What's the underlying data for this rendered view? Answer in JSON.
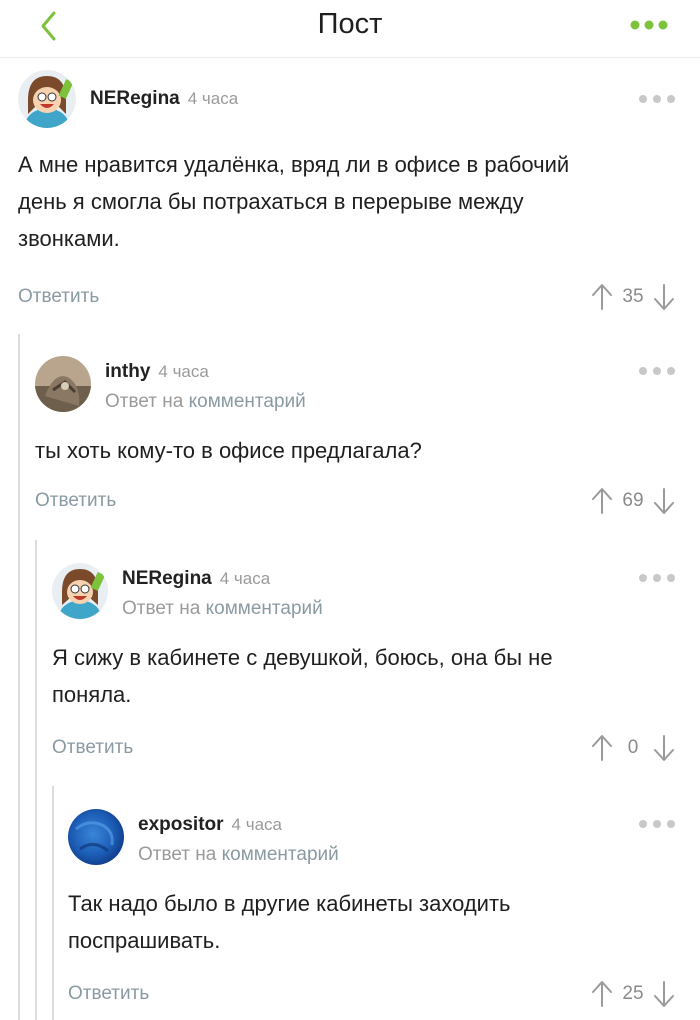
{
  "header": {
    "title": "Пост",
    "back_icon": "chevron-left-icon",
    "more_icon": "more-dots-icon",
    "accent": "#7cc33b"
  },
  "comments": [
    {
      "username": "NERegina",
      "time": "4 часа",
      "reply_to_prefix": "",
      "reply_to_link": "",
      "lines": [
        "А мне нравится удалёнка, вряд ли в офисе в рабочий",
        "день я смогла бы потрахаться в перерыве между",
        "звонками."
      ],
      "reply_label": "Ответить",
      "votes": "35"
    },
    {
      "username": "inthy",
      "time": "4 часа",
      "reply_to_prefix": "Ответ на",
      "reply_to_link": "комментарий",
      "lines": [
        "ты хоть кому-то в офисе предлагала?"
      ],
      "reply_label": "Ответить",
      "votes": "69"
    },
    {
      "username": "NERegina",
      "time": "4 часа",
      "reply_to_prefix": "Ответ на",
      "reply_to_link": "комментарий",
      "lines": [
        "Я сижу в кабинете с девушкой, боюсь, она бы не",
        "поняла."
      ],
      "reply_label": "Ответить",
      "votes": "0"
    },
    {
      "username": "expositor",
      "time": "4 часа",
      "reply_to_prefix": "Ответ на",
      "reply_to_link": "комментарий",
      "lines": [
        "Так надо было в другие кабинеты заходить",
        "поспрашивать."
      ],
      "reply_label": "Ответить",
      "votes": "25"
    }
  ]
}
